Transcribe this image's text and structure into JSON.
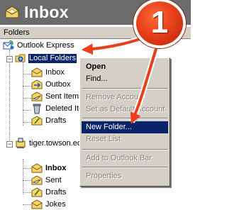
{
  "header": {
    "title": "Inbox",
    "icon": "inbox-icon"
  },
  "folders_pane": {
    "label": "Folders",
    "close": "×",
    "tree": {
      "root": "Outlook Express",
      "local_folders": {
        "label": "Local Folders",
        "children": [
          "Inbox",
          "Outbox",
          "Sent Items",
          "Deleted Items",
          "Drafts"
        ]
      },
      "account": {
        "label": "tiger.towson.edu",
        "children": [
          "Inbox",
          "Sent",
          "Drafts",
          "Jokes"
        ]
      }
    }
  },
  "context_menu": {
    "items": [
      {
        "label": "Open",
        "state": "default-bold"
      },
      {
        "label": "Find...",
        "state": "enabled"
      },
      {
        "label": "Remove Account",
        "state": "disabled"
      },
      {
        "label": "Set as Default Account",
        "state": "disabled"
      },
      {
        "label": "New Folder...",
        "state": "highlighted"
      },
      {
        "label": "Reset List",
        "state": "disabled"
      },
      {
        "label": "Add to Outlook Bar",
        "state": "disabled"
      },
      {
        "label": "Properties",
        "state": "disabled"
      }
    ]
  },
  "callout": {
    "number": "1",
    "color": "#e8401a"
  },
  "colors": {
    "selection": "#0a246a",
    "menu_bg": "#d4d0c8",
    "header_bg": "#6b6b6b"
  }
}
